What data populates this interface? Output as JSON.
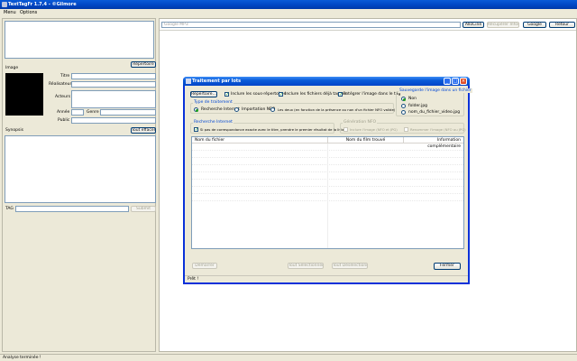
{
  "window": {
    "title": "TextTagFr 1.7.4 - ©Gilmore"
  },
  "menu": {
    "items": [
      "Menu",
      "Options"
    ]
  },
  "left": {
    "repertoire_btn": "Répertoire",
    "image_label": "Image",
    "titre_label": "Titre",
    "realisateur_label": "Réalisateur",
    "acteurs_label": "Acteurs",
    "annee_label": "Année",
    "genre_label": "Genre",
    "public_label": "Public",
    "synopsis_label": "Synopsis",
    "tout_effacer_btn": "Tout effacer",
    "tag_label": "TAG",
    "submit_btn": "Submit"
  },
  "search": {
    "placeholder": "Google MP3",
    "allocine_btn": "AlloCiné",
    "recuperer_btn": "Récupérer Infos",
    "google_btn": "Google",
    "retour_btn": "Retour"
  },
  "dialog": {
    "title": "Traitement par lots",
    "repertoire_btn": "Répertoire...",
    "inclure_sous_rep": "Inclure les sous-répertoires",
    "inclure_fichiers_tagges": "Inclure les fichiers déjà taggés",
    "integrer_image": "Intégrer l'image dans le tag",
    "sauvegarde_title": "Sauvegarde l'image dans un fichier",
    "sauvegarde_options": [
      "Non",
      "folder.jpg",
      "nom_du_fichier_video.jpg"
    ],
    "type_traitement_title": "Type de traitement",
    "type_options": [
      "Recherche Internet",
      "Importation NFO",
      "Les deux (en fonction de la présence ou non d'un fichier NFO valide)"
    ],
    "recherche_title": "Recherche Internet",
    "recherche_option": "Si pas de correspondance exacte avec le titre, prendre le premier résultat de la liste",
    "generation_title": "Génération NFO",
    "generation_options": [
      "Inclure l'image (NFO et JPG)",
      "Renommer l'image (NFO ou JPG)"
    ],
    "columns": [
      "Nom du fichier",
      "Nom du film trouvé",
      "Information complémentaire"
    ],
    "demarrer_btn": "Démarrer",
    "tout_selectionner_btn": "Tout Sélectionner",
    "tout_deselectionner_btn": "Tout Désélectionner",
    "fermer_btn": "Fermer",
    "status": "Prêt !"
  },
  "statusbar": {
    "text": "Analyse terminée !"
  }
}
